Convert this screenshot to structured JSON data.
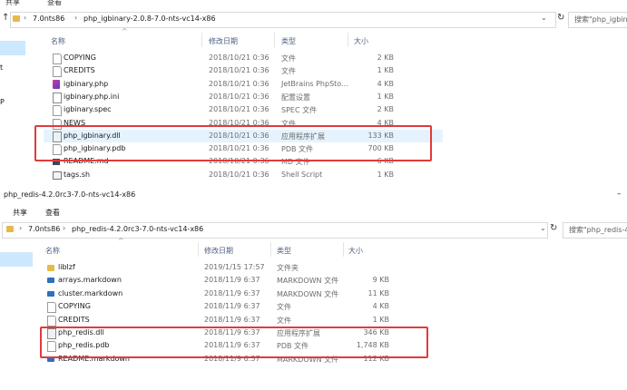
{
  "window1": {
    "menu": [
      "共享",
      "查看"
    ],
    "path": [
      "7.0nts86",
      "php_igbinary-2.0.8-7.0-nts-vc14-x86"
    ],
    "search_placeholder": "搜索\"php_igbin",
    "columns": {
      "name": "名称",
      "date": "修改日期",
      "type": "类型",
      "size": "大小"
    },
    "nav_fragments": [
      "t",
      "P"
    ],
    "files": [
      {
        "name": "COPYING",
        "date": "2018/10/21 0:36",
        "type": "文件",
        "size": "2 KB",
        "icon": "file-icon"
      },
      {
        "name": "CREDITS",
        "date": "2018/10/21 0:36",
        "type": "文件",
        "size": "1 KB",
        "icon": "file-icon"
      },
      {
        "name": "igbinary.php",
        "date": "2018/10/21 0:36",
        "type": "JetBrains PhpSto...",
        "size": "4 KB",
        "icon": "phpstorm-icon"
      },
      {
        "name": "igbinary.php.ini",
        "date": "2018/10/21 0:36",
        "type": "配置设置",
        "size": "1 KB",
        "icon": "settings-file-icon"
      },
      {
        "name": "igbinary.spec",
        "date": "2018/10/21 0:36",
        "type": "SPEC 文件",
        "size": "2 KB",
        "icon": "file-icon"
      },
      {
        "name": "NEWS",
        "date": "2018/10/21 0:36",
        "type": "文件",
        "size": "4 KB",
        "icon": "file-icon"
      },
      {
        "name": "php_igbinary.dll",
        "date": "2018/10/21 0:36",
        "type": "应用程序扩展",
        "size": "133 KB",
        "icon": "dll-icon"
      },
      {
        "name": "php_igbinary.pdb",
        "date": "2018/10/21 0:36",
        "type": "PDB 文件",
        "size": "700 KB",
        "icon": "file-icon"
      },
      {
        "name": "README.md",
        "date": "2018/10/21 0:36",
        "type": "MD 文件",
        "size": "6 KB",
        "icon": "md-icon"
      },
      {
        "name": "tags.sh",
        "date": "2018/10/21 0:36",
        "type": "Shell Script",
        "size": "1 KB",
        "icon": "script-icon"
      }
    ]
  },
  "window2": {
    "title": "php_redis-4.2.0rc3-7.0-nts-vc14-x86",
    "minimize": "–",
    "menu": [
      "共享",
      "查看"
    ],
    "path": [
      "7.0nts86",
      "php_redis-4.2.0rc3-7.0-nts-vc14-x86"
    ],
    "search_placeholder": "搜索\"php_redis-4",
    "columns": {
      "name": "名称",
      "date": "修改日期",
      "type": "类型",
      "size": "大小"
    },
    "files": [
      {
        "name": "liblzf",
        "date": "2019/1/15 17:57",
        "type": "文件夹",
        "size": "",
        "icon": "folder-icon"
      },
      {
        "name": "arrays.markdown",
        "date": "2018/11/9 6:37",
        "type": "MARKDOWN 文件",
        "size": "9 KB",
        "icon": "markdown-icon"
      },
      {
        "name": "cluster.markdown",
        "date": "2018/11/9 6:37",
        "type": "MARKDOWN 文件",
        "size": "11 KB",
        "icon": "markdown-icon"
      },
      {
        "name": "COPYING",
        "date": "2018/11/9 6:37",
        "type": "文件",
        "size": "4 KB",
        "icon": "file-icon"
      },
      {
        "name": "CREDITS",
        "date": "2018/11/9 6:37",
        "type": "文件",
        "size": "1 KB",
        "icon": "file-icon"
      },
      {
        "name": "php_redis.dll",
        "date": "2018/11/9 6:37",
        "type": "应用程序扩展",
        "size": "346 KB",
        "icon": "dll-icon"
      },
      {
        "name": "php_redis.pdb",
        "date": "2018/11/9 6:37",
        "type": "PDB 文件",
        "size": "1,748 KB",
        "icon": "file-icon"
      },
      {
        "name": "README.markdown",
        "date": "2018/11/9 6:37",
        "type": "MARKDOWN 文件",
        "size": "112 KB",
        "icon": "markdown-icon"
      }
    ]
  },
  "colors": {
    "highlight_box": "#e23a3a",
    "selected_row": "#e5f3ff",
    "header_text": "#4d6082"
  }
}
